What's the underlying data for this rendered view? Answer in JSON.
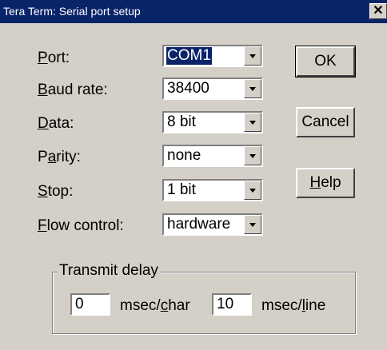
{
  "window": {
    "title": "Tera Term: Serial port setup",
    "close_glyph": "✕"
  },
  "fields": {
    "port": {
      "label_mnemonic": "P",
      "label_rest": "ort:",
      "value": "COM1"
    },
    "baud": {
      "label_mnemonic": "B",
      "label_rest": "aud rate:",
      "value": "38400"
    },
    "data": {
      "label_mnemonic": "D",
      "label_rest": "ata:",
      "value": "8 bit"
    },
    "parity": {
      "label_pre": "P",
      "label_mnemonic": "a",
      "label_rest": "rity:",
      "value": "none"
    },
    "stop": {
      "label_mnemonic": "S",
      "label_rest": "top:",
      "value": "1 bit"
    },
    "flow": {
      "label_mnemonic": "F",
      "label_rest": "low control:",
      "value": "hardware"
    }
  },
  "buttons": {
    "ok": "OK",
    "cancel": "Cancel",
    "help_mnemonic": "H",
    "help_rest": "elp"
  },
  "transmit_delay": {
    "title": "Transmit delay",
    "char_value": "0",
    "char_unit_pre": "msec/",
    "char_unit_mnemonic": "c",
    "char_unit_rest": "har",
    "line_value": "10",
    "line_unit_pre": "msec/",
    "line_unit_mnemonic": "l",
    "line_unit_rest": "ine"
  },
  "icons": {
    "dropdown": "chevron-down-icon",
    "close": "close-icon"
  }
}
